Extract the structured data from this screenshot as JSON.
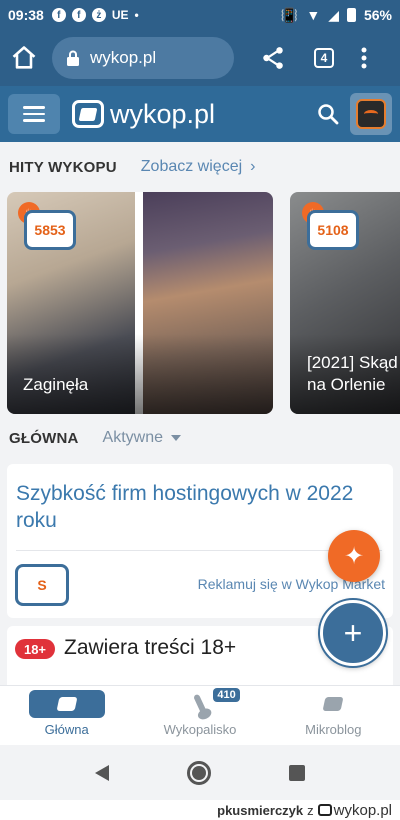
{
  "status_bar": {
    "time": "09:38",
    "notification_icons": [
      "f",
      "f",
      "ż"
    ],
    "carrier": "UE",
    "battery": "56%"
  },
  "browser": {
    "url": "wykop.pl",
    "tab_count": "4"
  },
  "site_header": {
    "logo_text": "wykop.pl"
  },
  "hits": {
    "title": "HITY WYKOPU",
    "see_more": "Zobacz więcej",
    "cards": [
      {
        "votes": "5853",
        "caption": "Zaginęła"
      },
      {
        "votes": "5108",
        "caption": "[2021] Skąd\nna Orlenie"
      }
    ]
  },
  "main_section": {
    "title": "GŁÓWNA",
    "filter": "Aktywne"
  },
  "article": {
    "title": "Szybkość firm hostingowych w 2022 roku",
    "source_letter": "S",
    "ad_link": "Reklamuj się w Wykop Market"
  },
  "adult_card": {
    "badge": "18+",
    "text": "Zawiera treści 18+"
  },
  "bottom_nav": {
    "items": [
      {
        "label": "Główna"
      },
      {
        "label": "Wykopalisko",
        "badge": "410"
      },
      {
        "label": "Mikroblog"
      }
    ]
  },
  "watermark": {
    "user": "pkusmierczyk",
    "joiner": "z",
    "site": "wykop.pl"
  },
  "colors": {
    "brand_blue": "#2e5f89",
    "accent_orange": "#f06a26",
    "link_blue": "#3b79ad",
    "adult_red": "#e0323a"
  }
}
